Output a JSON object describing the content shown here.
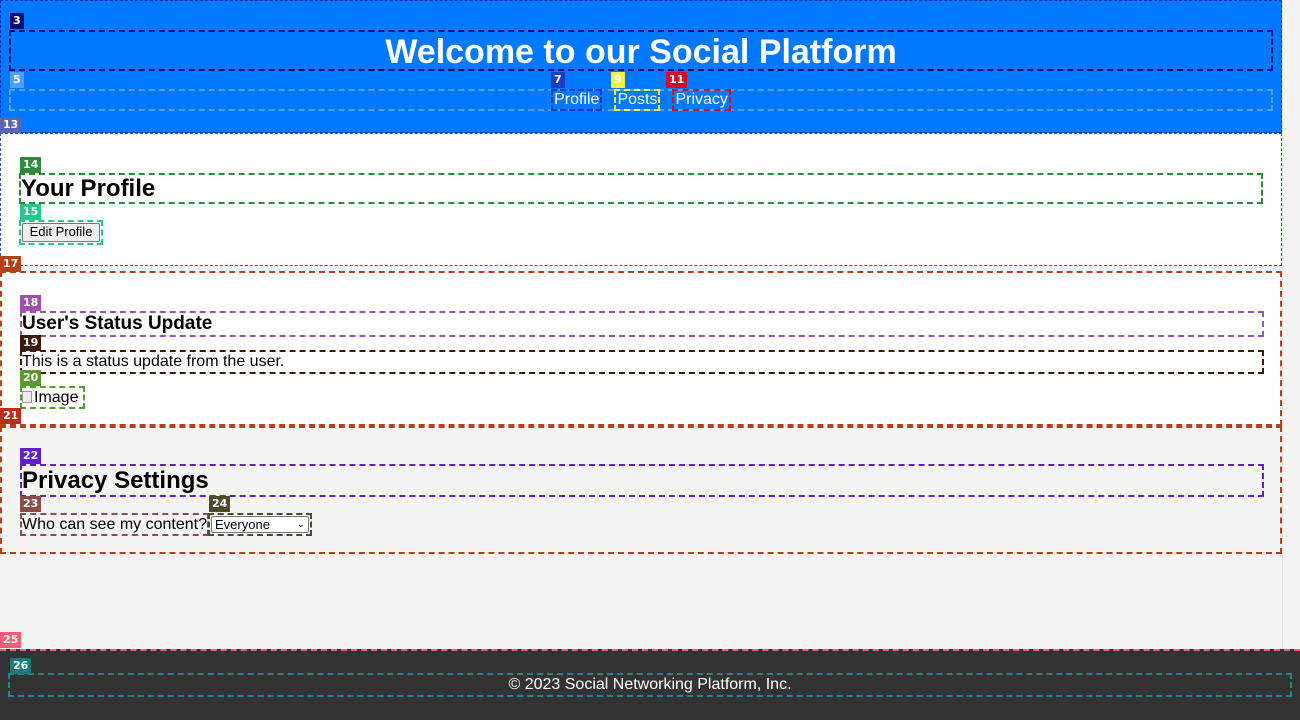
{
  "header": {
    "title": "Welcome to our Social Platform",
    "nav": {
      "profile": "Profile",
      "posts": "Posts",
      "privacy": "Privacy"
    }
  },
  "profile": {
    "heading": "Your Profile",
    "edit_button": "Edit Profile"
  },
  "status": {
    "heading": "User's Status Update",
    "text": "This is a status update from the user.",
    "image_alt": "Image"
  },
  "privacy": {
    "heading": "Privacy Settings",
    "label": "Who can see my content?",
    "selected_option": "Everyone"
  },
  "footer": {
    "text": "© 2023 Social Networking Platform, Inc."
  },
  "markers": {
    "m3": "3",
    "m5": "5",
    "m7": "7",
    "m9": "9",
    "m11": "11",
    "m13": "13",
    "m14": "14",
    "m15": "15",
    "m17": "17",
    "m18": "18",
    "m19": "19",
    "m20": "20",
    "m21": "21",
    "m22": "22",
    "m23": "23",
    "m24": "24",
    "m25": "25",
    "m26": "26"
  },
  "colors": {
    "header_bg": "#0078ff",
    "footer_bg": "#333333",
    "page_bg": "#f4f4f4"
  }
}
